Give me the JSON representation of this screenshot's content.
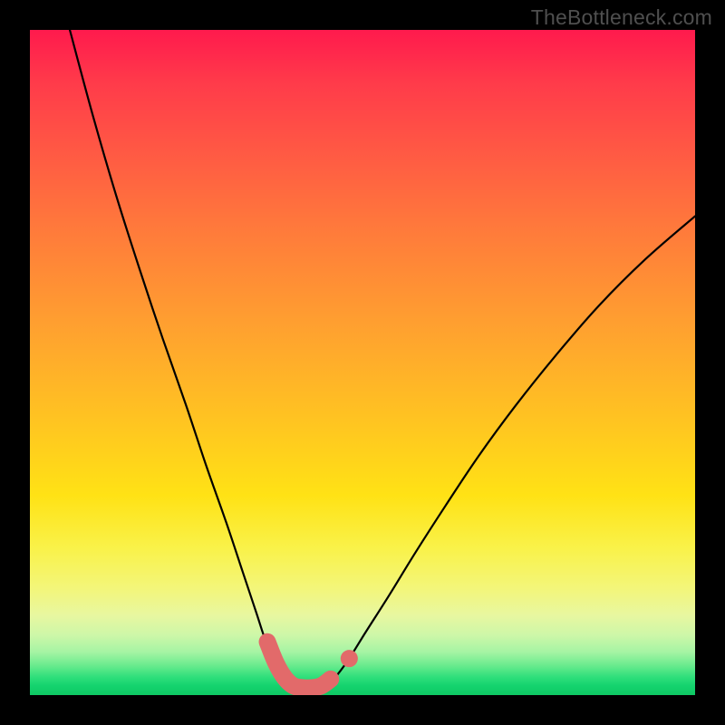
{
  "watermark": "TheBottleneck.com",
  "chart_data": {
    "type": "line",
    "title": "",
    "xlabel": "",
    "ylabel": "",
    "xlim": [
      0,
      1
    ],
    "ylim": [
      0,
      1
    ],
    "curve1": {
      "description": "left V-branch curve descending from top-left into trough",
      "points": [
        {
          "x": 0.06,
          "y": 1.0
        },
        {
          "x": 0.095,
          "y": 0.87
        },
        {
          "x": 0.13,
          "y": 0.75
        },
        {
          "x": 0.165,
          "y": 0.64
        },
        {
          "x": 0.2,
          "y": 0.535
        },
        {
          "x": 0.235,
          "y": 0.435
        },
        {
          "x": 0.265,
          "y": 0.345
        },
        {
          "x": 0.295,
          "y": 0.26
        },
        {
          "x": 0.32,
          "y": 0.185
        },
        {
          "x": 0.34,
          "y": 0.125
        },
        {
          "x": 0.355,
          "y": 0.08
        },
        {
          "x": 0.37,
          "y": 0.048
        },
        {
          "x": 0.385,
          "y": 0.028
        },
        {
          "x": 0.4,
          "y": 0.015
        },
        {
          "x": 0.415,
          "y": 0.01
        },
        {
          "x": 0.43,
          "y": 0.01
        },
        {
          "x": 0.445,
          "y": 0.015
        }
      ]
    },
    "curve2": {
      "description": "right V-branch curve ascending from trough toward upper-right",
      "points": [
        {
          "x": 0.445,
          "y": 0.015
        },
        {
          "x": 0.46,
          "y": 0.028
        },
        {
          "x": 0.48,
          "y": 0.055
        },
        {
          "x": 0.505,
          "y": 0.095
        },
        {
          "x": 0.54,
          "y": 0.15
        },
        {
          "x": 0.58,
          "y": 0.215
        },
        {
          "x": 0.625,
          "y": 0.285
        },
        {
          "x": 0.675,
          "y": 0.36
        },
        {
          "x": 0.73,
          "y": 0.435
        },
        {
          "x": 0.79,
          "y": 0.51
        },
        {
          "x": 0.855,
          "y": 0.585
        },
        {
          "x": 0.925,
          "y": 0.655
        },
        {
          "x": 1.0,
          "y": 0.72
        }
      ]
    },
    "trough_markers": {
      "description": "thick salmon-colored stroke along the trough plus single dot on right side",
      "radius_norm": 0.013,
      "segment": [
        {
          "x": 0.357,
          "y": 0.08
        },
        {
          "x": 0.37,
          "y": 0.048
        },
        {
          "x": 0.383,
          "y": 0.026
        },
        {
          "x": 0.396,
          "y": 0.014
        },
        {
          "x": 0.41,
          "y": 0.011
        },
        {
          "x": 0.424,
          "y": 0.011
        },
        {
          "x": 0.438,
          "y": 0.014
        },
        {
          "x": 0.452,
          "y": 0.024
        }
      ],
      "isolated_dot": {
        "x": 0.48,
        "y": 0.055
      }
    },
    "colors": {
      "curve": "#000000",
      "markers": "#e26a6a",
      "background_top": "#ff1a4d",
      "background_bottom": "#0fc964"
    }
  }
}
